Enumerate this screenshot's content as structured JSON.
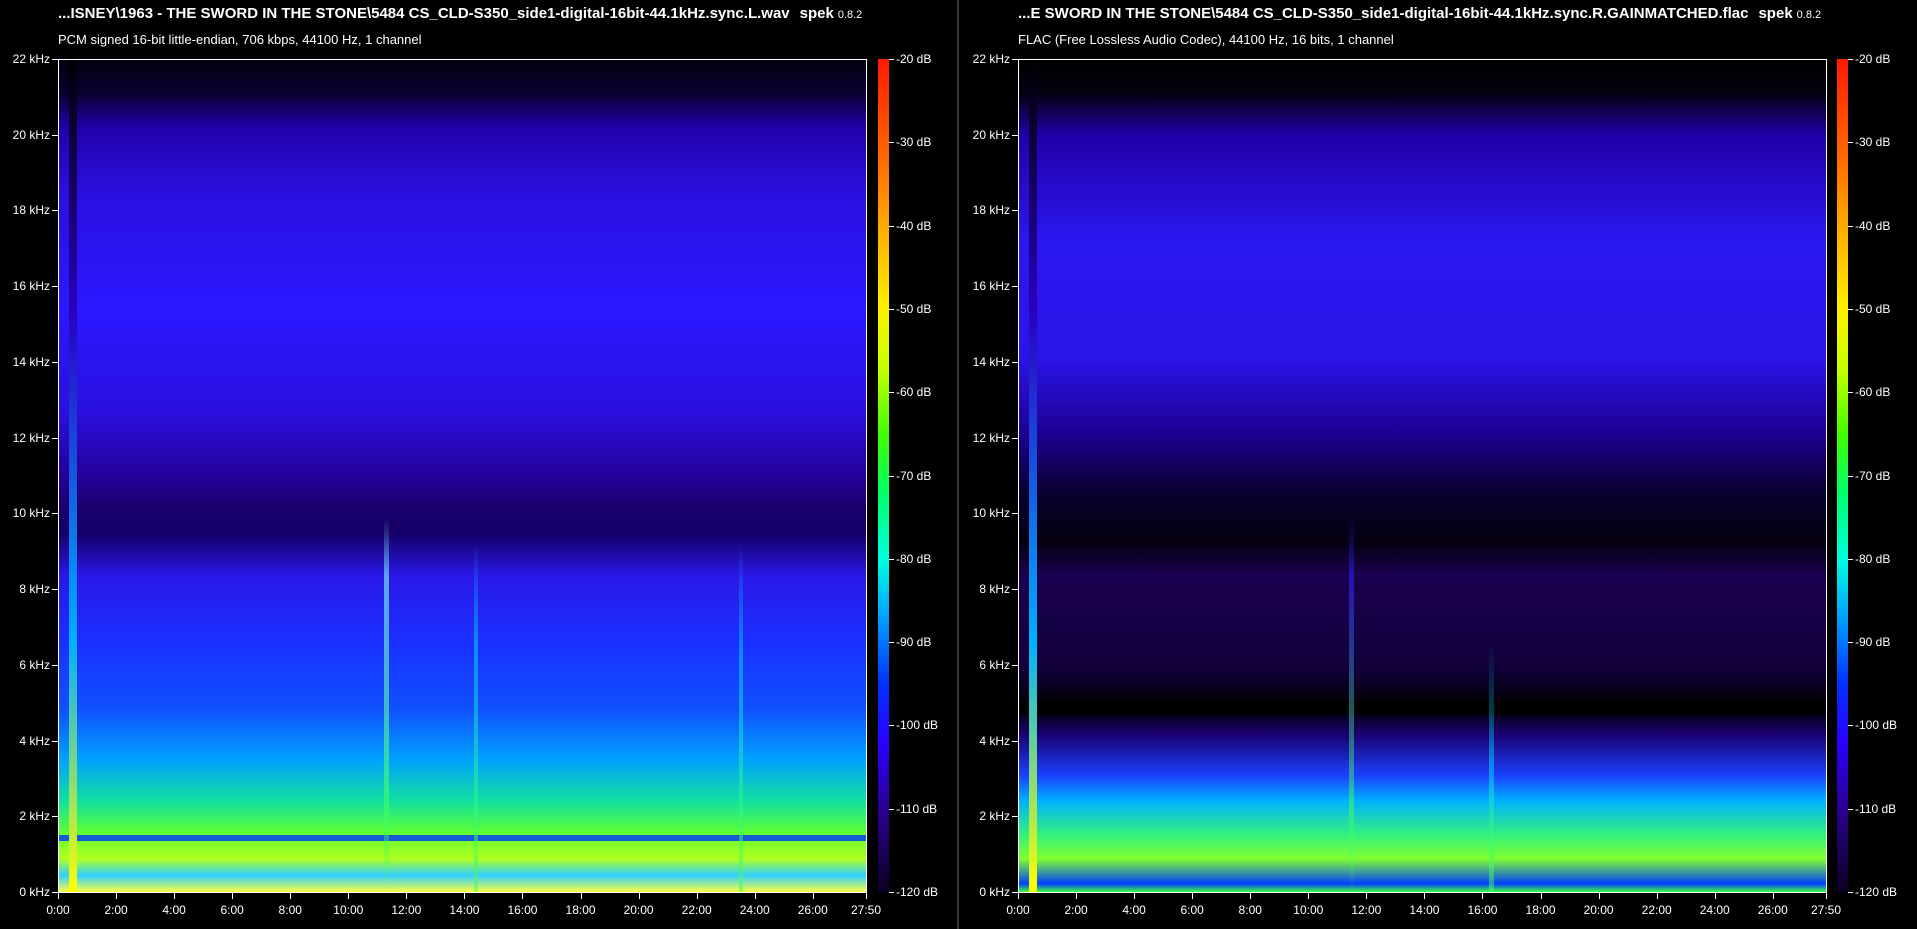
{
  "panels": [
    {
      "title": "...ISNEY\\1963 - THE SWORD IN THE STONE\\5484 CS_CLD-S350_side1-digital-16bit-44.1kHz.sync.L.wav",
      "app_name": "spek",
      "app_version": "0.8.2",
      "subtitle": "PCM signed 16-bit little-endian, 706 kbps, 44100 Hz, 1 channel"
    },
    {
      "title": "...E SWORD IN THE STONE\\5484 CS_CLD-S350_side1-digital-16bit-44.1kHz.sync.R.GAINMATCHED.flac",
      "app_name": "spek",
      "app_version": "0.8.2",
      "subtitle": "FLAC (Free Lossless Audio Codec), 44100 Hz, 16 bits, 1 channel"
    }
  ],
  "y_axis_labels": [
    "22 kHz",
    "20 kHz",
    "18 kHz",
    "16 kHz",
    "14 kHz",
    "12 kHz",
    "10 kHz",
    "8 kHz",
    "6 kHz",
    "4 kHz",
    "2 kHz",
    "0 kHz"
  ],
  "x_axis_labels": [
    "0:00",
    "2:00",
    "4:00",
    "6:00",
    "8:00",
    "10:00",
    "12:00",
    "14:00",
    "16:00",
    "18:00",
    "20:00",
    "22:00",
    "24:00",
    "26:00",
    "27:50"
  ],
  "db_labels": [
    "-20 dB",
    "-30 dB",
    "-40 dB",
    "-50 dB",
    "-60 dB",
    "-70 dB",
    "-80 dB",
    "-90 dB",
    "-100 dB",
    "-110 dB",
    "-120 dB"
  ]
}
